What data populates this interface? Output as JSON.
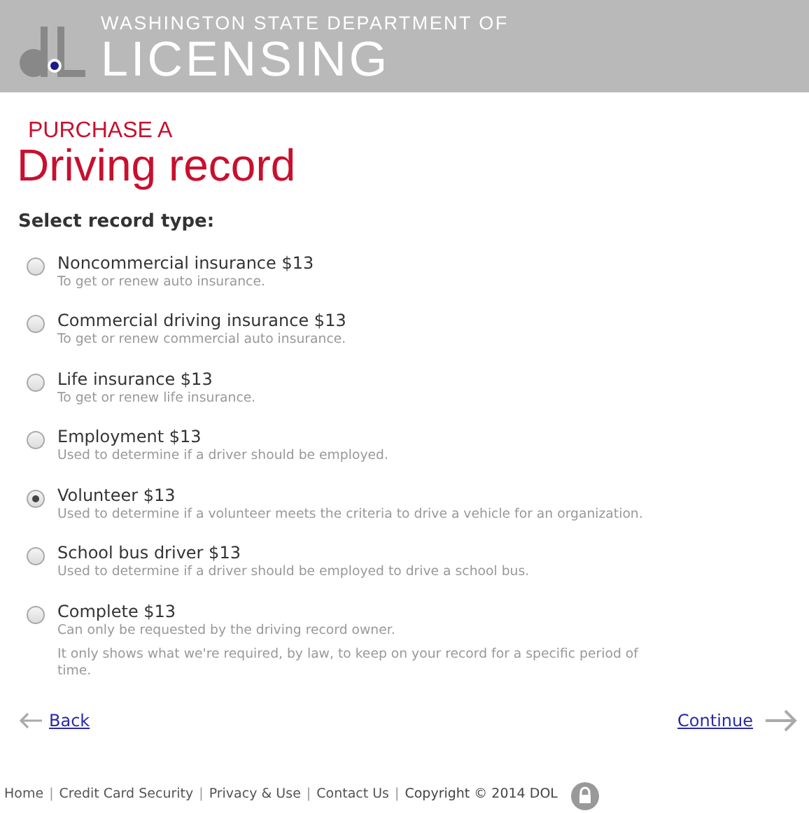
{
  "header": {
    "subtitle": "WASHINGTON STATE DEPARTMENT OF",
    "title": "LICENSING"
  },
  "page_title": {
    "kicker": "PURCHASE A",
    "title": "Driving record"
  },
  "prompt": "Select record type:",
  "options": [
    {
      "label": "Noncommercial insurance $13",
      "descriptions": [
        "To get or renew auto insurance."
      ],
      "selected": false
    },
    {
      "label": "Commercial driving insurance $13",
      "descriptions": [
        "To get or renew commercial auto insurance."
      ],
      "selected": false
    },
    {
      "label": "Life insurance $13",
      "descriptions": [
        "To get or renew life insurance."
      ],
      "selected": false
    },
    {
      "label": "Employment $13",
      "descriptions": [
        "Used to determine if a driver should be employed."
      ],
      "selected": false
    },
    {
      "label": "Volunteer $13",
      "descriptions": [
        "Used to determine if a volunteer meets the criteria to drive a vehicle for an organization."
      ],
      "selected": true
    },
    {
      "label": "School bus driver $13",
      "descriptions": [
        "Used to determine if a driver should be employed to drive a school bus."
      ],
      "selected": false
    },
    {
      "label": "Complete $13",
      "descriptions": [
        "Can only be requested by the driving record owner.",
        "It only shows what we're required, by law, to keep on your record for a specific period of time."
      ],
      "selected": false
    }
  ],
  "nav": {
    "back": "Back",
    "continue": "Continue"
  },
  "footer": [
    {
      "kind": "link",
      "text": "Home"
    },
    {
      "kind": "separator",
      "text": "|"
    },
    {
      "kind": "link",
      "text": "Credit Card Security"
    },
    {
      "kind": "separator",
      "text": "|"
    },
    {
      "kind": "link",
      "text": "Privacy & Use"
    },
    {
      "kind": "separator",
      "text": "|"
    },
    {
      "kind": "link",
      "text": "Contact Us"
    },
    {
      "kind": "separator",
      "text": "|"
    },
    {
      "kind": "text",
      "text": "Copyright © 2014 DOL"
    }
  ]
}
